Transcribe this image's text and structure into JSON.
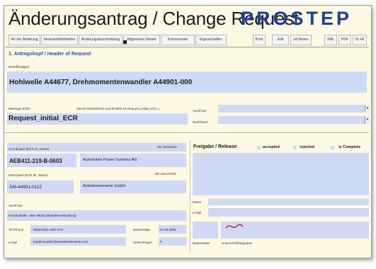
{
  "header": {
    "title": "Änderungsantrag / Change Request",
    "logo_text": "PROSTEP"
  },
  "toolbar": {
    "tabs": [
      "Art der Änderung",
      "Verantwortlichkeiten",
      "Änderungsbeschreibung",
      "Allgemeine Details",
      "Kommentare",
      "Eigenschaften"
    ],
    "buttons": [
      "Print",
      "Edit",
      "ref Memo",
      "XML",
      "PDF",
      "XL+R"
    ]
  },
  "section1": {
    "title": "1. Antragskopf / Header of Request",
    "subject_label": "Betreff/Subject",
    "subject_value": "Hohlwelle A44677, Drehmomentenwandler A44901-000",
    "message_label": "Message EOID",
    "message_id": "161447342/AE0411-219-B-0603.01.Request_initial_ECR.1",
    "message_value": "Request_initial_ECR",
    "von_label": "Von/From",
    "nach_label": "Nach/Next"
  },
  "coordinator": {
    "label": "Coordinator (ECR ID, Name)",
    "id": "DE 16636203",
    "code": "AEB411-219-B-0603",
    "company": "Automotive Power Systems AG"
  },
  "participant": {
    "label": "Participant (ECR ID, Name)",
    "id": "DE 161447342",
    "code": "ÄM-44901-0112",
    "company": "Antriebselemente GmbH"
  },
  "contact": {
    "label": "Von/From",
    "name": "Harald Müller, ABK WEZ5 (Wandlerentwicklung)",
    "tel_label": "Tel./Phone",
    "tel_value": "0049-6151-4287-270",
    "date_label": "Datum/Date",
    "date_value": "27.03.2006",
    "email_label": "e-mail",
    "email_value": "harald.mueller@antriebselemente.com",
    "pages_label": "Seiten/Pages",
    "pages_value": "#"
  },
  "release": {
    "title": "Freigabe / Release",
    "accepted": "accepted",
    "rejected": "rejected",
    "complete": "is Complete",
    "name_label": "Name",
    "email_label": "e-mail",
    "date_label": "Datum/Date",
    "signature_label": "Unterschrift/Signature"
  },
  "colors": {
    "field": "#cfd9f6",
    "background": "#fdf9e3",
    "section_title": "#2c54b4",
    "logo": "#1c3f9e"
  }
}
